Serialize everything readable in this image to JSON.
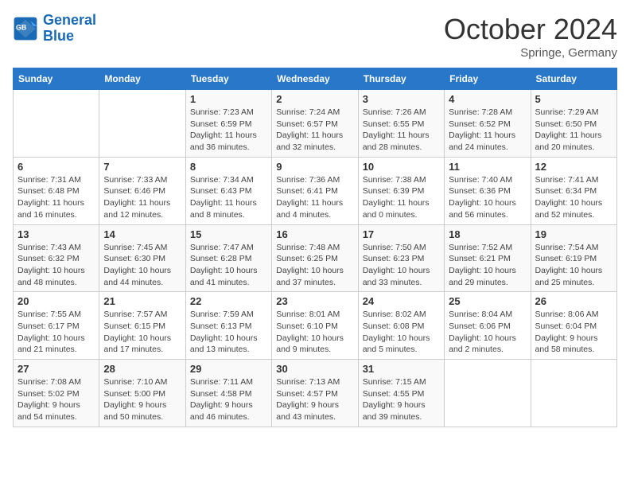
{
  "header": {
    "logo_line1": "General",
    "logo_line2": "Blue",
    "month": "October 2024",
    "location": "Springe, Germany"
  },
  "days_of_week": [
    "Sunday",
    "Monday",
    "Tuesday",
    "Wednesday",
    "Thursday",
    "Friday",
    "Saturday"
  ],
  "weeks": [
    [
      {
        "day": "",
        "detail": ""
      },
      {
        "day": "",
        "detail": ""
      },
      {
        "day": "1",
        "detail": "Sunrise: 7:23 AM\nSunset: 6:59 PM\nDaylight: 11 hours and 36 minutes."
      },
      {
        "day": "2",
        "detail": "Sunrise: 7:24 AM\nSunset: 6:57 PM\nDaylight: 11 hours and 32 minutes."
      },
      {
        "day": "3",
        "detail": "Sunrise: 7:26 AM\nSunset: 6:55 PM\nDaylight: 11 hours and 28 minutes."
      },
      {
        "day": "4",
        "detail": "Sunrise: 7:28 AM\nSunset: 6:52 PM\nDaylight: 11 hours and 24 minutes."
      },
      {
        "day": "5",
        "detail": "Sunrise: 7:29 AM\nSunset: 6:50 PM\nDaylight: 11 hours and 20 minutes."
      }
    ],
    [
      {
        "day": "6",
        "detail": "Sunrise: 7:31 AM\nSunset: 6:48 PM\nDaylight: 11 hours and 16 minutes."
      },
      {
        "day": "7",
        "detail": "Sunrise: 7:33 AM\nSunset: 6:46 PM\nDaylight: 11 hours and 12 minutes."
      },
      {
        "day": "8",
        "detail": "Sunrise: 7:34 AM\nSunset: 6:43 PM\nDaylight: 11 hours and 8 minutes."
      },
      {
        "day": "9",
        "detail": "Sunrise: 7:36 AM\nSunset: 6:41 PM\nDaylight: 11 hours and 4 minutes."
      },
      {
        "day": "10",
        "detail": "Sunrise: 7:38 AM\nSunset: 6:39 PM\nDaylight: 11 hours and 0 minutes."
      },
      {
        "day": "11",
        "detail": "Sunrise: 7:40 AM\nSunset: 6:36 PM\nDaylight: 10 hours and 56 minutes."
      },
      {
        "day": "12",
        "detail": "Sunrise: 7:41 AM\nSunset: 6:34 PM\nDaylight: 10 hours and 52 minutes."
      }
    ],
    [
      {
        "day": "13",
        "detail": "Sunrise: 7:43 AM\nSunset: 6:32 PM\nDaylight: 10 hours and 48 minutes."
      },
      {
        "day": "14",
        "detail": "Sunrise: 7:45 AM\nSunset: 6:30 PM\nDaylight: 10 hours and 44 minutes."
      },
      {
        "day": "15",
        "detail": "Sunrise: 7:47 AM\nSunset: 6:28 PM\nDaylight: 10 hours and 41 minutes."
      },
      {
        "day": "16",
        "detail": "Sunrise: 7:48 AM\nSunset: 6:25 PM\nDaylight: 10 hours and 37 minutes."
      },
      {
        "day": "17",
        "detail": "Sunrise: 7:50 AM\nSunset: 6:23 PM\nDaylight: 10 hours and 33 minutes."
      },
      {
        "day": "18",
        "detail": "Sunrise: 7:52 AM\nSunset: 6:21 PM\nDaylight: 10 hours and 29 minutes."
      },
      {
        "day": "19",
        "detail": "Sunrise: 7:54 AM\nSunset: 6:19 PM\nDaylight: 10 hours and 25 minutes."
      }
    ],
    [
      {
        "day": "20",
        "detail": "Sunrise: 7:55 AM\nSunset: 6:17 PM\nDaylight: 10 hours and 21 minutes."
      },
      {
        "day": "21",
        "detail": "Sunrise: 7:57 AM\nSunset: 6:15 PM\nDaylight: 10 hours and 17 minutes."
      },
      {
        "day": "22",
        "detail": "Sunrise: 7:59 AM\nSunset: 6:13 PM\nDaylight: 10 hours and 13 minutes."
      },
      {
        "day": "23",
        "detail": "Sunrise: 8:01 AM\nSunset: 6:10 PM\nDaylight: 10 hours and 9 minutes."
      },
      {
        "day": "24",
        "detail": "Sunrise: 8:02 AM\nSunset: 6:08 PM\nDaylight: 10 hours and 5 minutes."
      },
      {
        "day": "25",
        "detail": "Sunrise: 8:04 AM\nSunset: 6:06 PM\nDaylight: 10 hours and 2 minutes."
      },
      {
        "day": "26",
        "detail": "Sunrise: 8:06 AM\nSunset: 6:04 PM\nDaylight: 9 hours and 58 minutes."
      }
    ],
    [
      {
        "day": "27",
        "detail": "Sunrise: 7:08 AM\nSunset: 5:02 PM\nDaylight: 9 hours and 54 minutes."
      },
      {
        "day": "28",
        "detail": "Sunrise: 7:10 AM\nSunset: 5:00 PM\nDaylight: 9 hours and 50 minutes."
      },
      {
        "day": "29",
        "detail": "Sunrise: 7:11 AM\nSunset: 4:58 PM\nDaylight: 9 hours and 46 minutes."
      },
      {
        "day": "30",
        "detail": "Sunrise: 7:13 AM\nSunset: 4:57 PM\nDaylight: 9 hours and 43 minutes."
      },
      {
        "day": "31",
        "detail": "Sunrise: 7:15 AM\nSunset: 4:55 PM\nDaylight: 9 hours and 39 minutes."
      },
      {
        "day": "",
        "detail": ""
      },
      {
        "day": "",
        "detail": ""
      }
    ]
  ]
}
